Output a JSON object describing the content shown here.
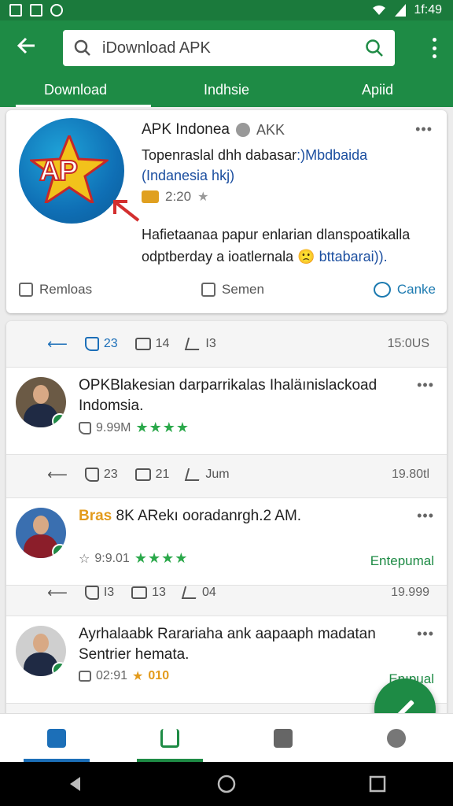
{
  "status_bar": {
    "time": "1f:49"
  },
  "app_bar": {
    "search_text": "iDownload APK",
    "tabs": [
      {
        "label": "Download",
        "active": true
      },
      {
        "label": "Indhsie",
        "active": false
      },
      {
        "label": "Apiid",
        "active": false
      }
    ]
  },
  "app_card": {
    "name": "APK Indonea",
    "badge_text": "AKK",
    "desc_line1": "Topenraslal dhh dabasar",
    "desc_line1_blue": ":)Mbdbaida",
    "desc_line2": "(Indanesia hkj)",
    "rating": "2:20",
    "long_line1": "Hafietaanaa papur enlarian dlanspoatikalla",
    "long_line2": "odptberday a ioatlernala",
    "long_line2_blue": "bttabarai)).",
    "actions": {
      "reminder": "Remloas",
      "semen": "Semen",
      "canke": "Canke"
    }
  },
  "stats": [
    {
      "likes": "23",
      "comments": "14",
      "shares": "I3",
      "time": "15:0US"
    },
    {
      "likes": "23",
      "comments": "21",
      "shares": "Jum",
      "time": "19.80tl"
    },
    {
      "likes": "I3",
      "comments": "13",
      "shares": "04",
      "time": "19.999"
    }
  ],
  "posts": [
    {
      "text": "OPKBlakesian darparrikalas Ihaläınislackoad Indomsia.",
      "meta": "9.99M",
      "stars": "★★★★",
      "link": ""
    },
    {
      "prefix": "Bras",
      "text": " 8K ARekı ooradanrgh.2 AM.",
      "meta": "9:9.01",
      "stars": "★★★★",
      "link": "Entepumal"
    },
    {
      "text": "Ayrhalaabk Rarariaha ank aapaaph madatan Sentrier hemata.",
      "meta": "02:91",
      "stars": "★",
      "orange_num": "010",
      "link": "Enıpual"
    }
  ],
  "colors": {
    "primary": "#1e8b45",
    "status_bar": "#1b7a3c",
    "link_blue": "#1c4fa0"
  }
}
